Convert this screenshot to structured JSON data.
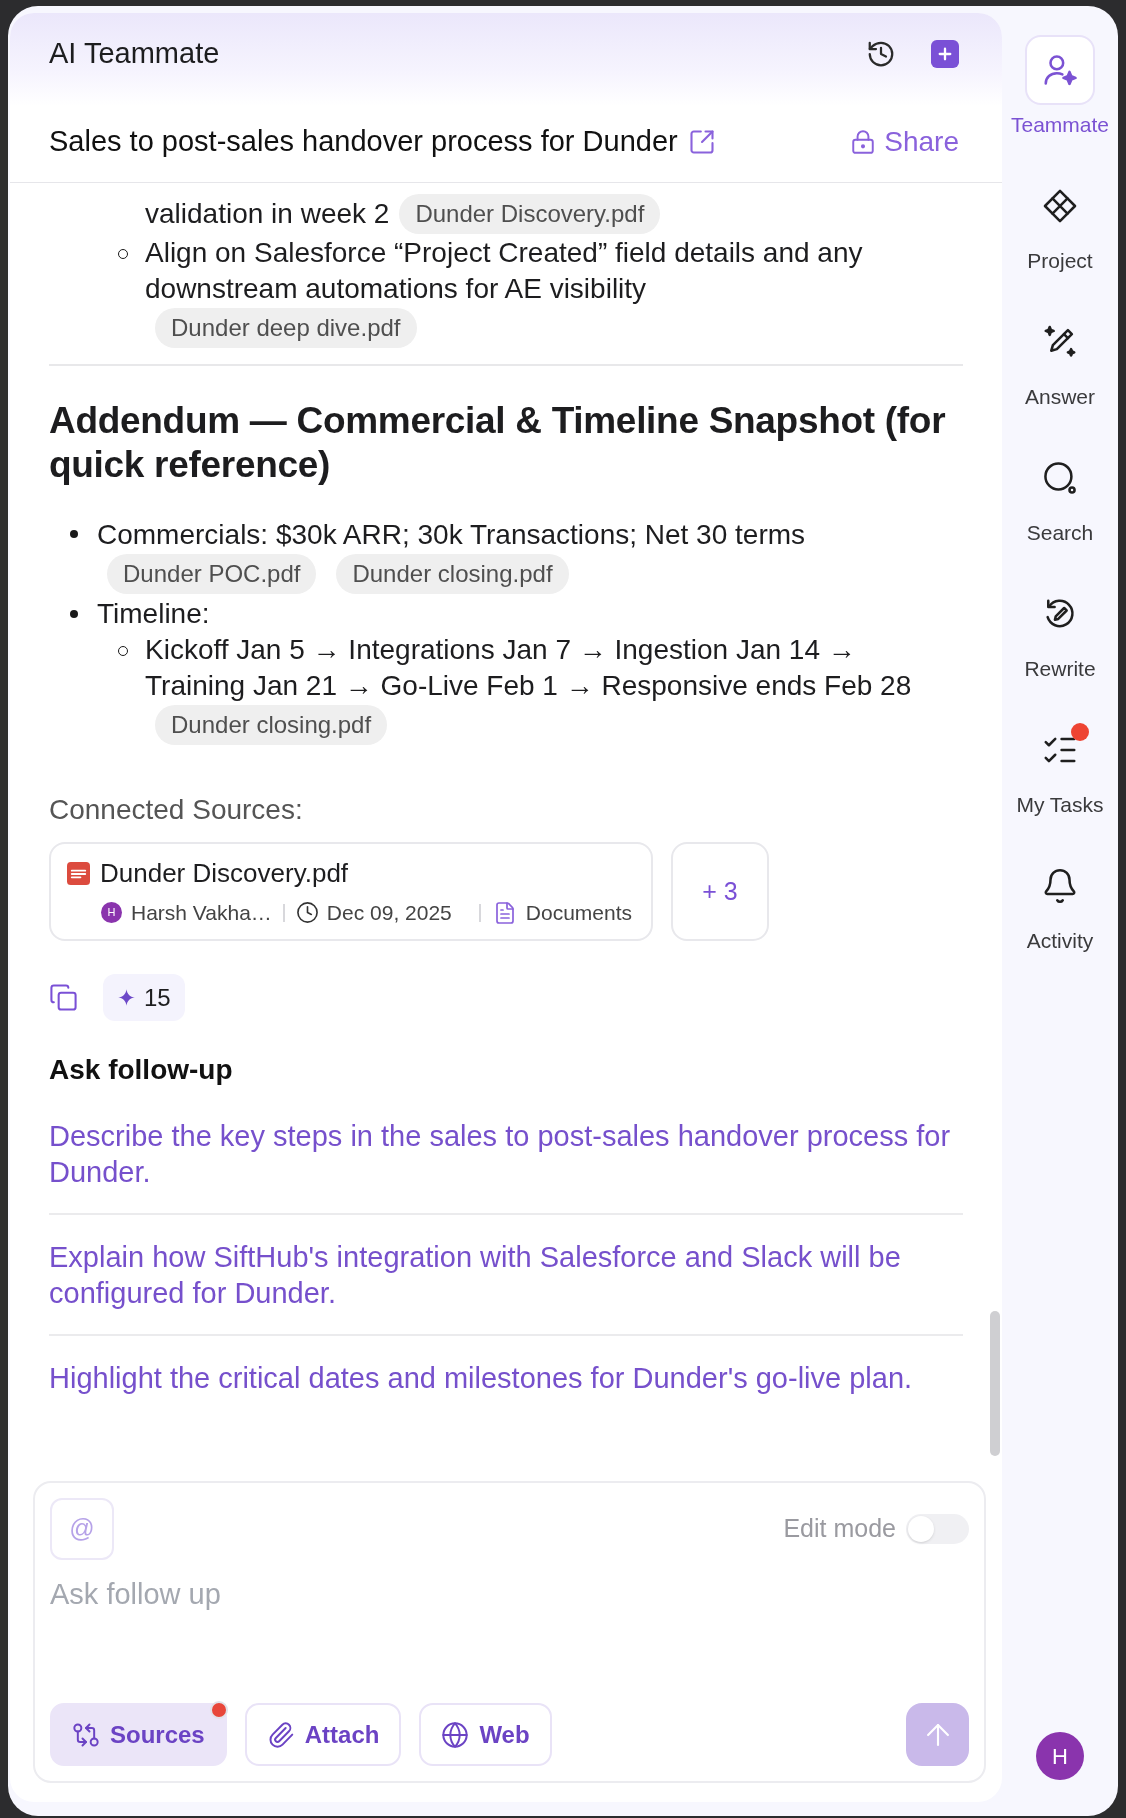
{
  "window": {
    "title": "AI Teammate"
  },
  "conversation": {
    "title": "Sales to post-sales handover process for Dunder",
    "share": "Share"
  },
  "answer": {
    "continued_item": {
      "text": "validation in week 2",
      "sources": [
        "Dunder Discovery.pdf"
      ]
    },
    "items": [
      {
        "text": "Align on Salesforce “Project Created” field details and any downstream automations for AE visibility",
        "sources": [
          "Dunder deep dive.pdf"
        ]
      }
    ],
    "addendum": {
      "heading": "Addendum — Commercial & Timeline Snapshot (for quick reference)",
      "items": [
        {
          "text": "Commercials: $30k ARR; 30k Transactions; Net 30 terms",
          "sources": [
            "Dunder POC.pdf",
            "Dunder closing.pdf"
          ]
        },
        {
          "text": "Timeline:",
          "children": [
            {
              "text": "Kickoff Jan 5 → Integrations Jan 7 → Ingestion Jan 14 → Training Jan 21 → Go-Live Feb 1 → Responsive ends Feb 28",
              "sources": [
                "Dunder closing.pdf"
              ]
            }
          ]
        }
      ]
    }
  },
  "connected_sources": {
    "label": "Connected Sources:",
    "sources": [
      {
        "name": "Dunder Discovery.pdf",
        "owner_initial": "H",
        "owner": "Harsh Vakha…",
        "date": "Dec 09, 2025",
        "type": "Documents"
      }
    ],
    "more": "+ 3"
  },
  "actions": {
    "credits": "15"
  },
  "follow_up": {
    "heading": "Ask follow-up",
    "suggestions": [
      "Describe the key steps in the sales to post-sales handover process for Dunder.",
      "Explain how SiftHub's integration with Salesforce and Slack will be configured for Dunder.",
      "Highlight the critical dates and milestones for Dunder's go-live plan."
    ]
  },
  "composer": {
    "mention": "@",
    "edit_mode": {
      "label": "Edit mode",
      "on": false
    },
    "placeholder": "Ask follow up",
    "buttons": [
      {
        "label": "Sources",
        "kind": "sources",
        "selected": true,
        "notification": true
      },
      {
        "label": "Attach",
        "kind": "attach",
        "selected": false,
        "notification": false
      },
      {
        "label": "Web",
        "kind": "web",
        "selected": false,
        "notification": false
      }
    ],
    "send": {
      "disabled": true
    }
  },
  "sidebar": {
    "items": [
      {
        "label": "Teammate",
        "kind": "teammate",
        "selected": true,
        "badge": false
      },
      {
        "label": "Project",
        "kind": "project",
        "selected": false,
        "badge": false
      },
      {
        "label": "Answer",
        "kind": "answer",
        "selected": false,
        "badge": false
      },
      {
        "label": "Search",
        "kind": "search",
        "selected": false,
        "badge": false
      },
      {
        "label": "Rewrite",
        "kind": "rewrite",
        "selected": false,
        "badge": false
      },
      {
        "label": "My Tasks",
        "kind": "tasks",
        "selected": false,
        "badge": true
      },
      {
        "label": "Activity",
        "kind": "activity",
        "selected": false,
        "badge": false
      }
    ],
    "user_initial": "H"
  }
}
